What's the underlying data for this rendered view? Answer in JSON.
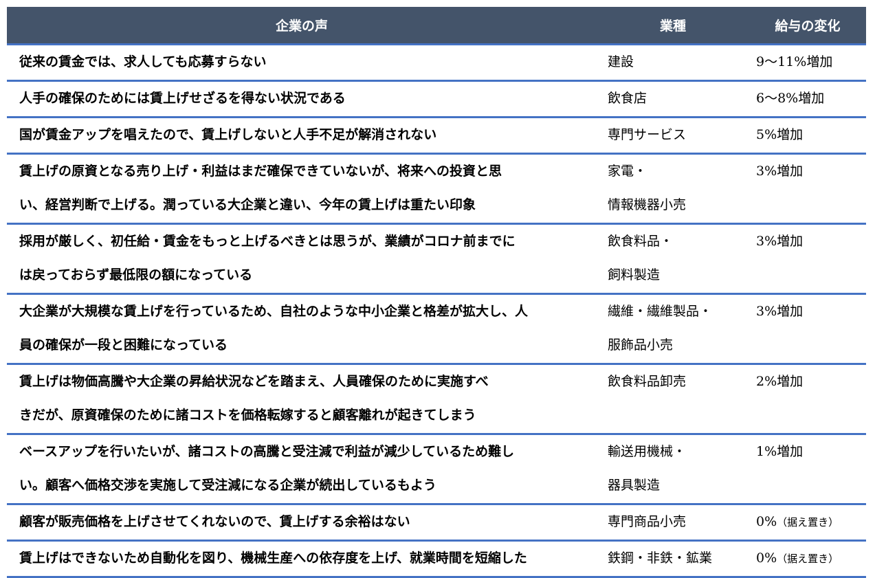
{
  "header": {
    "voice": "企業の声",
    "industry": "業種",
    "pay_change": "給与の変化"
  },
  "rows": [
    {
      "voice": "従来の賃金では、求人しても応募すらない",
      "industry": "建設",
      "pay": "9～11%増加",
      "note": ""
    },
    {
      "voice": "人手の確保のためには賃上げせざるを得ない状況である",
      "industry": "飲食店",
      "pay": "6～8%増加",
      "note": ""
    },
    {
      "voice": "国が賃金アップを唱えたので、賃上げしないと人手不足が解消されない",
      "industry": "専門サービス",
      "pay": "5%増加",
      "note": ""
    },
    {
      "voice": "賃上げの原資となる売り上げ・利益はまだ確保できていないが、将来への投資と思\nい、経営判断で上げる。潤っている大企業と違い、今年の賃上げは重たい印象",
      "industry": "家電・\n情報機器小売",
      "pay": "3%増加",
      "note": ""
    },
    {
      "voice": "採用が厳しく、初任給・賃金をもっと上げるべきとは思うが、業績がコロナ前までに\nは戻っておらず最低限の額になっている",
      "industry": "飲食料品・\n飼料製造",
      "pay": "3%増加",
      "note": ""
    },
    {
      "voice": "大企業が大規模な賃上げを行っているため、自社のような中小企業と格差が拡大し、人\n員の確保が一段と困難になっている",
      "industry": "繊維・繊維製品・\n服飾品小売",
      "pay": "3%増加",
      "note": ""
    },
    {
      "voice": "賃上げは物価高騰や大企業の昇給状況などを踏まえ、人員確保のために実施すべ\nきだが、原資確保のために諸コストを価格転嫁すると顧客離れが起きてしまう",
      "industry": "飲食料品卸売",
      "pay": "2%増加",
      "note": ""
    },
    {
      "voice": "ベースアップを行いたいが、諸コストの高騰と受注減で利益が減少しているため難し\nい。顧客へ価格交渉を実施して受注減になる企業が続出しているもよう",
      "industry": "輸送用機械・\n器具製造",
      "pay": "1%増加",
      "note": ""
    },
    {
      "voice": "顧客が販売価格を上げさせてくれないので、賃上げする余裕はない",
      "industry": "専門商品小売",
      "pay": "0%",
      "note": "（据え置き）"
    },
    {
      "voice": "賃上げはできないため自動化を図り、機械生産への依存度を上げ、就業時間を短縮した",
      "industry": "鉄鋼・非鉄・鉱業",
      "pay": "0%",
      "note": "（据え置き）"
    }
  ],
  "colors": {
    "header_bg": "#44546a",
    "header_text": "#ffffff",
    "row_divider": "#4472c4"
  }
}
